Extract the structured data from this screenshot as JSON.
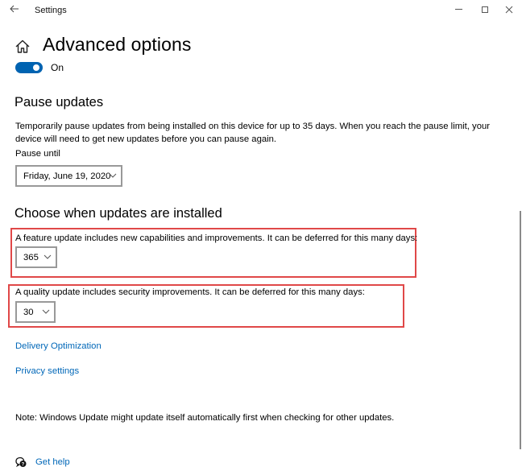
{
  "window": {
    "title": "Settings",
    "controls": {
      "minimize": "minimize-icon",
      "maximize": "maximize-icon",
      "close": "close-icon"
    },
    "back": "back-arrow-icon"
  },
  "header": {
    "home_icon": "home-icon",
    "title": "Advanced options",
    "toggle": {
      "state": "On",
      "on": true
    }
  },
  "pause": {
    "heading": "Pause updates",
    "description": "Temporarily pause updates from being installed on this device for up to 35 days. When you reach the pause limit, your device will need to get new updates before you can pause again.",
    "until_label": "Pause until",
    "until_value": "Friday, June 19, 2020"
  },
  "choose": {
    "heading": "Choose when updates are installed",
    "feature": {
      "label": "A feature update includes new capabilities and improvements. It can be deferred for this many days:",
      "value": "365"
    },
    "quality": {
      "label": "A quality update includes security improvements. It can be deferred for this many days:",
      "value": "30"
    }
  },
  "links": {
    "delivery": "Delivery Optimization",
    "privacy": "Privacy settings"
  },
  "note": "Note: Windows Update might update itself automatically first when checking for other updates.",
  "help": {
    "icon": "get-help-icon",
    "label": "Get help"
  },
  "colors": {
    "accent": "#0063b1",
    "link": "#0067b8",
    "highlight": "#e04848"
  }
}
